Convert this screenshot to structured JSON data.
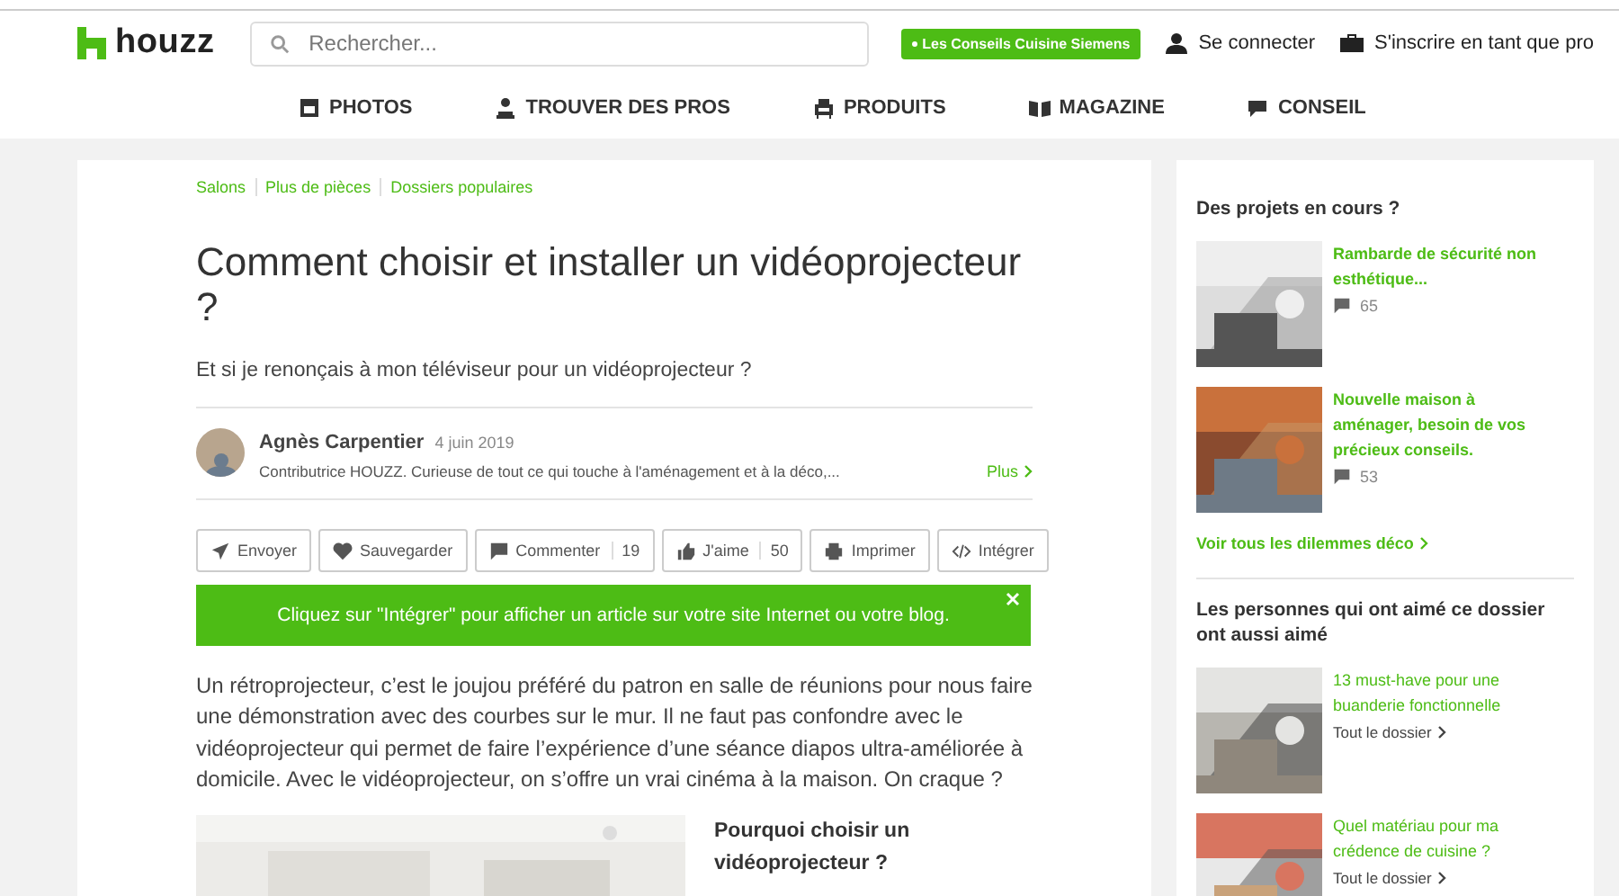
{
  "header": {
    "logo": "houzz",
    "search": {
      "placeholder": "Rechercher..."
    },
    "promo": "Les Conseils Cuisine Siemens",
    "login": "Se connecter",
    "pro_signup": "S'inscrire en tant que pro"
  },
  "nav": [
    {
      "kind": "photos",
      "label": "PHOTOS"
    },
    {
      "kind": "pros",
      "label": "TROUVER DES PROS"
    },
    {
      "kind": "products",
      "label": "PRODUITS"
    },
    {
      "kind": "magazine",
      "label": "MAGAZINE"
    },
    {
      "kind": "advice",
      "label": "CONSEIL"
    }
  ],
  "article": {
    "breadcrumbs": [
      "Salons",
      "Plus de pièces",
      "Dossiers populaires"
    ],
    "title": "Comment choisir et installer un vidéoprojecteur ?",
    "subtitle": "Et si je renonçais à mon téléviseur pour un vidéoprojecteur ?",
    "author": {
      "name": "Agnès Carpentier",
      "date": "4 juin 2019",
      "bio": "Contributrice HOUZZ. Curieuse de tout ce qui touche à l'aménagement et à la déco,...",
      "more": "Plus"
    },
    "actions": [
      {
        "kind": "send",
        "label": "Envoyer"
      },
      {
        "kind": "save",
        "label": "Sauvegarder"
      },
      {
        "kind": "comment",
        "label": "Commenter",
        "count": "19"
      },
      {
        "kind": "like",
        "label": "J'aime",
        "count": "50"
      },
      {
        "kind": "print",
        "label": "Imprimer"
      },
      {
        "kind": "embed",
        "label": "Intégrer"
      }
    ],
    "tip": "Cliquez sur \"Intégrer\" pour afficher un article sur votre site Internet ou votre blog.",
    "body": "Un rétroprojecteur, c’est le joujou préféré du patron en salle de réunions pour nous faire une démonstration avec des courbes sur le mur. Il ne faut pas confondre avec le vidéoprojecteur qui permet de faire l’expérience d’une séance diapos ultra-améliorée à domicile. Avec le vidéoprojecteur, on s’offre un vrai cinéma à la maison. On craque ?",
    "section_title": "Pourquoi choisir un vidéoprojecteur ?"
  },
  "sidebar": {
    "projects": {
      "title": "Des projets en cours ?",
      "items": [
        {
          "title": "Rambarde de sécurité non esthétique...",
          "comments": "65"
        },
        {
          "title": "Nouvelle maison à aménager, besoin de vos précieux conseils.",
          "comments": "53"
        }
      ],
      "link": "Voir tous les dilemmes déco"
    },
    "related": {
      "title": "Les personnes qui ont aimé ce dossier ont aussi aimé",
      "items": [
        {
          "title": "13 must-have pour une buanderie fonctionnelle",
          "link": "Tout le dossier"
        },
        {
          "title": "Quel matériau pour ma crédence de cuisine ?",
          "link": "Tout le dossier"
        }
      ]
    }
  }
}
